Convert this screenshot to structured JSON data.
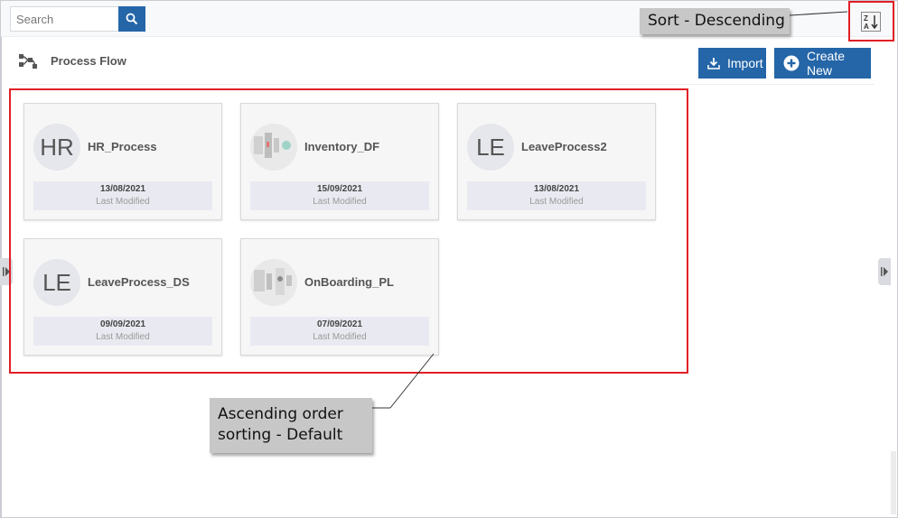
{
  "search": {
    "placeholder": "Search",
    "value": ""
  },
  "header": {
    "title": "Process Flow",
    "import_label": "Import",
    "create_label": "Create New"
  },
  "cards": [
    {
      "initials": "HR",
      "name": "HR_Process",
      "date": "13/08/2021",
      "modified_label": "Last Modified",
      "thumbnail": false
    },
    {
      "initials": "",
      "name": "Inventory_DF",
      "date": "15/09/2021",
      "modified_label": "Last Modified",
      "thumbnail": true
    },
    {
      "initials": "LE",
      "name": "LeaveProcess2",
      "date": "13/08/2021",
      "modified_label": "Last Modified",
      "thumbnail": false
    },
    {
      "initials": "LE",
      "name": "LeaveProcess_DS",
      "date": "09/09/2021",
      "modified_label": "Last Modified",
      "thumbnail": false
    },
    {
      "initials": "",
      "name": "OnBoarding_PL",
      "date": "07/09/2021",
      "modified_label": "Last Modified",
      "thumbnail": true
    }
  ],
  "annotations": {
    "sort_descending": "Sort - Descending",
    "ascending_line1": "Ascending order",
    "ascending_line2": "sorting - Default"
  },
  "sort_icon": {
    "top": "Z",
    "bottom": "A"
  },
  "colors": {
    "accent": "#2466a8",
    "highlight": "#e01f26",
    "callout_bg": "#c7c7c7"
  }
}
